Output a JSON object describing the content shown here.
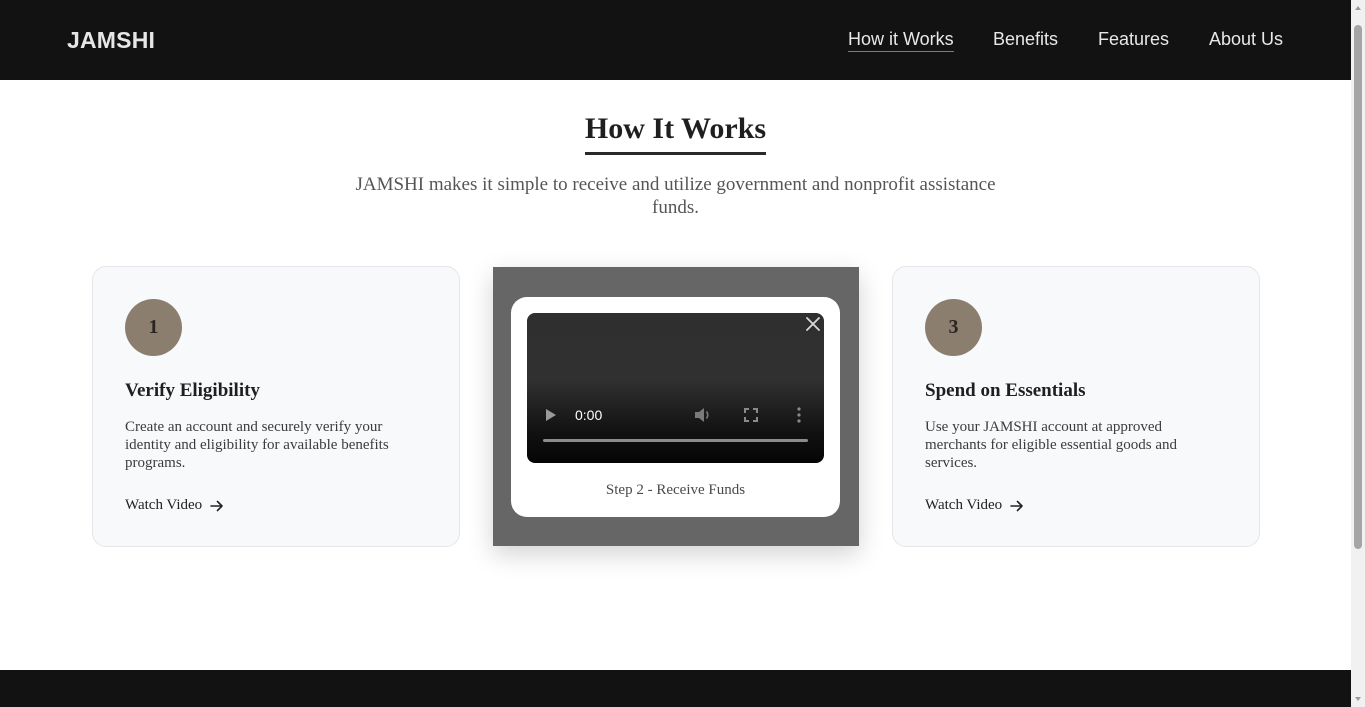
{
  "header": {
    "logo": "JAMSHI",
    "nav": [
      {
        "label": "How it Works",
        "active": true
      },
      {
        "label": "Benefits",
        "active": false
      },
      {
        "label": "Features",
        "active": false
      },
      {
        "label": "About Us",
        "active": false
      }
    ]
  },
  "section": {
    "title": "How It Works",
    "subtitle": "JAMSHI makes it simple to receive and utilize government and nonprofit assistance funds."
  },
  "steps": [
    {
      "number": "1",
      "title": "Verify Eligibility",
      "description": "Create an account and securely verify your identity and eligibility for available benefits programs.",
      "link_label": "Watch Video",
      "link_icon": "arrow-right-icon"
    },
    {
      "number": "3",
      "title": "Spend on Essentials",
      "description": "Use your JAMSHI account at approved merchants for eligible essential goods and services.",
      "link_label": "Watch Video",
      "link_icon": "arrow-right-icon"
    }
  ],
  "video_modal": {
    "caption": "Step 2 - Receive Funds",
    "current_time": "0:00",
    "progress": 0,
    "icons": [
      "play-icon",
      "volume-icon",
      "fullscreen-icon",
      "more-options-icon",
      "close-icon"
    ]
  },
  "colors": {
    "nav_background": "#121212",
    "badge": "#8c7e6f",
    "overlay": "#666666",
    "card_background": "#f8f9fa"
  }
}
